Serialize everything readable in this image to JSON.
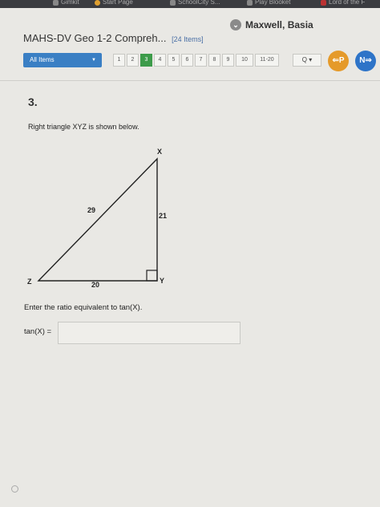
{
  "bookmarks": [
    {
      "label": "Gimkit",
      "icon": "gimkit-icon"
    },
    {
      "label": "Start Page",
      "icon": "start-page-icon"
    },
    {
      "label": "SchoolCity S...",
      "icon": "schoolcity-icon"
    },
    {
      "label": "Play Blooket",
      "icon": "blooket-icon"
    },
    {
      "label": "Lord of the F",
      "icon": "book-icon"
    }
  ],
  "header": {
    "user_name": "Maxwell, Basia",
    "user_chevron": "⌄",
    "test_title": "MAHS-DV Geo 1-2 Compreh...",
    "item_count": "[24 Items]"
  },
  "toolbar": {
    "item_select": "All Items",
    "item_select_caret": "▼",
    "pages": [
      "1",
      "2",
      "3",
      "4",
      "5",
      "6",
      "7",
      "8",
      "9",
      "10",
      "11-20"
    ],
    "active_page": "3",
    "search_label": "Q ▾",
    "prev_label": "⇐P",
    "next_label": "N⇒",
    "colors": {
      "select": "#3a7fc4",
      "active_page": "#3d9b4a",
      "prev": "#e59a2a",
      "next": "#2e74c8"
    }
  },
  "question": {
    "number": "3.",
    "text": "Right triangle XYZ is shown below.",
    "triangle": {
      "vertex_x": "X",
      "vertex_y": "Y",
      "vertex_z": "Z",
      "side_xz": "29",
      "side_xy": "21",
      "side_zy": "20"
    },
    "prompt": "Enter the ratio equivalent to tan(X).",
    "answer_label": "tan(X) =",
    "answer_value": ""
  }
}
